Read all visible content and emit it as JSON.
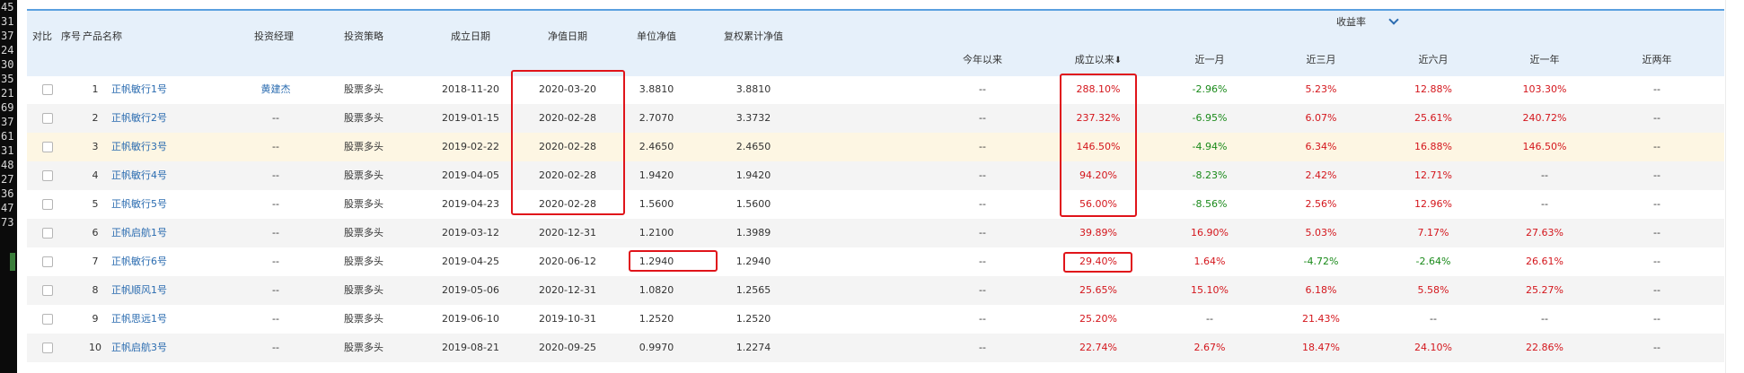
{
  "gutter_numbers": [
    "45",
    "31",
    "37",
    "24",
    "30",
    "35",
    "21",
    "69",
    "37",
    "61",
    "31",
    "48",
    "27",
    "36",
    "47",
    "73"
  ],
  "headers": {
    "compare": "对比",
    "index": "序号",
    "product": "产品名称",
    "manager": "投资经理",
    "strategy": "投资策略",
    "found_date": "成立日期",
    "nav_date": "净值日期",
    "unit_nav": "单位净值",
    "cum_nav": "复权累计净值",
    "return_group": "收益率",
    "ytd": "今年以来",
    "since_inception": "成立以来",
    "sort_arrow": "⬇",
    "m1": "近一月",
    "m3": "近三月",
    "m6": "近六月",
    "y1": "近一年",
    "y2": "近两年"
  },
  "rows": [
    {
      "idx": "1",
      "name": "正帆敏行1号",
      "manager": "黄建杰",
      "strategy": "股票多头",
      "found": "2018-11-20",
      "nav_date": "2020-03-20",
      "unit": "3.8810",
      "cum": "3.8810",
      "ytd": "--",
      "since": "288.10%",
      "m1": "-2.96%",
      "m3": "5.23%",
      "m6": "12.88%",
      "y1": "103.30%",
      "y2": "--"
    },
    {
      "idx": "2",
      "name": "正帆敏行2号",
      "manager": "--",
      "strategy": "股票多头",
      "found": "2019-01-15",
      "nav_date": "2020-02-28",
      "unit": "2.7070",
      "cum": "3.3732",
      "ytd": "--",
      "since": "237.32%",
      "m1": "-6.95%",
      "m3": "6.07%",
      "m6": "25.61%",
      "y1": "240.72%",
      "y2": "--"
    },
    {
      "idx": "3",
      "name": "正帆敏行3号",
      "manager": "--",
      "strategy": "股票多头",
      "found": "2019-02-22",
      "nav_date": "2020-02-28",
      "unit": "2.4650",
      "cum": "2.4650",
      "ytd": "--",
      "since": "146.50%",
      "m1": "-4.94%",
      "m3": "6.34%",
      "m6": "16.88%",
      "y1": "146.50%",
      "y2": "--"
    },
    {
      "idx": "4",
      "name": "正帆敏行4号",
      "manager": "--",
      "strategy": "股票多头",
      "found": "2019-04-05",
      "nav_date": "2020-02-28",
      "unit": "1.9420",
      "cum": "1.9420",
      "ytd": "--",
      "since": "94.20%",
      "m1": "-8.23%",
      "m3": "2.42%",
      "m6": "12.71%",
      "y1": "--",
      "y2": "--"
    },
    {
      "idx": "5",
      "name": "正帆敏行5号",
      "manager": "--",
      "strategy": "股票多头",
      "found": "2019-04-23",
      "nav_date": "2020-02-28",
      "unit": "1.5600",
      "cum": "1.5600",
      "ytd": "--",
      "since": "56.00%",
      "m1": "-8.56%",
      "m3": "2.56%",
      "m6": "12.96%",
      "y1": "--",
      "y2": "--"
    },
    {
      "idx": "6",
      "name": "正帆启航1号",
      "manager": "--",
      "strategy": "股票多头",
      "found": "2019-03-12",
      "nav_date": "2020-12-31",
      "unit": "1.2100",
      "cum": "1.3989",
      "ytd": "--",
      "since": "39.89%",
      "m1": "16.90%",
      "m3": "5.03%",
      "m6": "7.17%",
      "y1": "27.63%",
      "y2": "--"
    },
    {
      "idx": "7",
      "name": "正帆敏行6号",
      "manager": "--",
      "strategy": "股票多头",
      "found": "2019-04-25",
      "nav_date": "2020-06-12",
      "unit": "1.2940",
      "cum": "1.2940",
      "ytd": "--",
      "since": "29.40%",
      "m1": "1.64%",
      "m3": "-4.72%",
      "m6": "-2.64%",
      "y1": "26.61%",
      "y2": "--"
    },
    {
      "idx": "8",
      "name": "正帆顺风1号",
      "manager": "--",
      "strategy": "股票多头",
      "found": "2019-05-06",
      "nav_date": "2020-12-31",
      "unit": "1.0820",
      "cum": "1.2565",
      "ytd": "--",
      "since": "25.65%",
      "m1": "15.10%",
      "m3": "6.18%",
      "m6": "5.58%",
      "y1": "25.27%",
      "y2": "--"
    },
    {
      "idx": "9",
      "name": "正帆思远1号",
      "manager": "--",
      "strategy": "股票多头",
      "found": "2019-06-10",
      "nav_date": "2019-10-31",
      "unit": "1.2520",
      "cum": "1.2520",
      "ytd": "--",
      "since": "25.20%",
      "m1": "--",
      "m3": "21.43%",
      "m6": "--",
      "y1": "--",
      "y2": "--"
    },
    {
      "idx": "10",
      "name": "正帆启航3号",
      "manager": "--",
      "strategy": "股票多头",
      "found": "2019-08-21",
      "nav_date": "2020-09-25",
      "unit": "0.9970",
      "cum": "1.2274",
      "ytd": "--",
      "since": "22.74%",
      "m1": "2.67%",
      "m3": "18.47%",
      "m6": "24.10%",
      "y1": "22.86%",
      "y2": "--"
    }
  ],
  "colors": {
    "header_bg": "#e6f0fa",
    "link": "#2b6cb0",
    "positive": "#d4161c",
    "negative": "#1a8a1a",
    "highlight_row": "#fdf6e3",
    "annotation_box": "#e0141a"
  },
  "icons": {
    "return_group_toggle": "chevron-down-icon",
    "sort": "sort-down-icon",
    "row_select": "checkbox-icon"
  }
}
